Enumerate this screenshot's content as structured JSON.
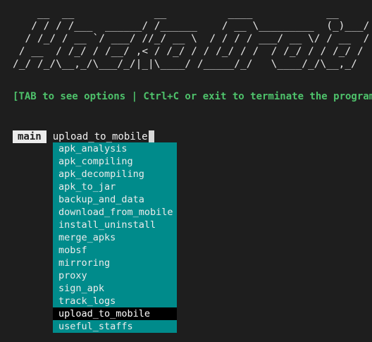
{
  "banner": {
    "ascii_art": "    __  __             __          ____            __\n   / / / /___  ______/ /______    / __ \\_________  (_)___/ /\n  / /_/ / __ `/ ___/ //_/ __ \\  / / / / ___/ __ \\/ / __  /\n / __  / /_/ / /__/ ,< / /_/ / / /_/ / /  / /_/ / / /_/ /\n/_/ /_/\\__,_/\\___/_/|_|\\____/ /_____/_/   \\____/_/\\__,_/"
  },
  "hint": {
    "text": "[TAB to see options | Ctrl+C or exit to terminate the program]"
  },
  "prompt": {
    "badge": "main",
    "input_value": "upload_to_mobile"
  },
  "completions": {
    "selected": "upload_to_mobile",
    "items": [
      "apk_analysis",
      "apk_compiling",
      "apk_decompiling",
      "apk_to_jar",
      "backup_and_data",
      "download_from_mobile",
      "install_uninstall",
      "merge_apks",
      "mobsf",
      "mirroring",
      "proxy",
      "sign_apk",
      "track_logs",
      "upload_to_mobile",
      "useful_staffs"
    ]
  },
  "colors": {
    "background": "#1e1e1e",
    "hint_green": "#4ec26b",
    "menu_teal": "#008b8b",
    "menu_selected": "#000000",
    "badge_bg": "#ececec"
  }
}
